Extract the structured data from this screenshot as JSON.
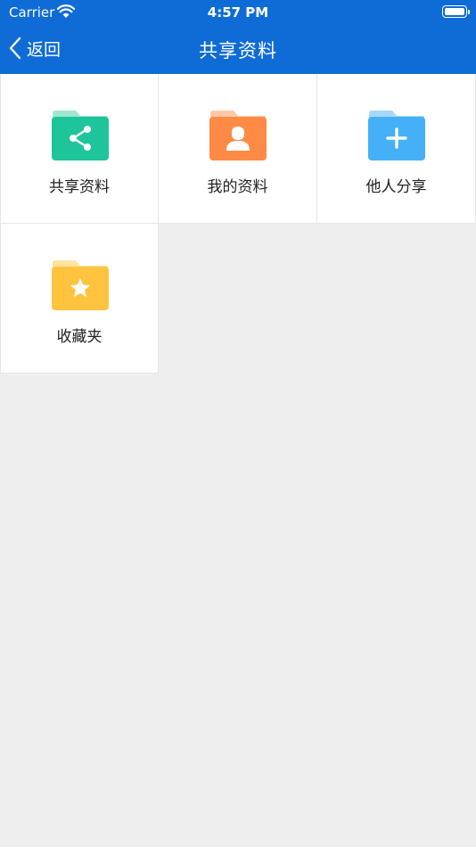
{
  "status_bar": {
    "carrier": "Carrier",
    "time": "4:57 PM"
  },
  "nav": {
    "back_label": "返回",
    "title": "共享资料"
  },
  "tiles": [
    {
      "label": "共享资料",
      "icon": "share-icon",
      "color": "#1fc59a",
      "tab_color": "#9fe6d0"
    },
    {
      "label": "我的资料",
      "icon": "person-icon",
      "color": "#ff8a45",
      "tab_color": "#ffc9a6"
    },
    {
      "label": "他人分享",
      "icon": "plus-icon",
      "color": "#45b0f7",
      "tab_color": "#a6d8fb"
    },
    {
      "label": "收藏夹",
      "icon": "star-icon",
      "color": "#ffc43f",
      "tab_color": "#ffe39f"
    }
  ],
  "colors": {
    "header": "#0f6cd6",
    "background": "#eeeeee"
  }
}
